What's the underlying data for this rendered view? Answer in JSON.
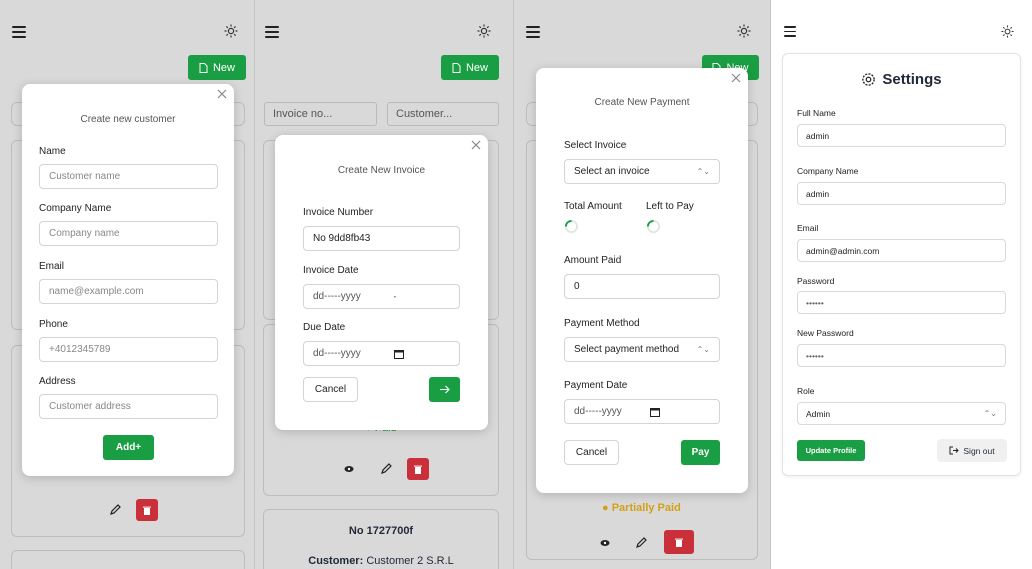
{
  "colors": {
    "accent": "#1a9e43",
    "danger": "#c9303a",
    "warning": "#d4a017"
  },
  "panel1": {
    "new_label": "New",
    "modal": {
      "title": "Create new customer",
      "fields": [
        {
          "label": "Name",
          "placeholder": "Customer name"
        },
        {
          "label": "Company Name",
          "placeholder": "Company name"
        },
        {
          "label": "Email",
          "placeholder": "name@example.com"
        },
        {
          "label": "Phone",
          "placeholder": "+4012345789"
        },
        {
          "label": "Address",
          "placeholder": "Customer address"
        }
      ],
      "add_label": "Add+"
    }
  },
  "panel2": {
    "new_label": "New",
    "filter_invoice": "Invoice no...",
    "filter_customer": "Customer...",
    "status_partial": "Paid",
    "card_invoice": "No 1727700f",
    "card_customer_label": "Customer:",
    "card_customer_value": "Customer 2 S.R.L",
    "modal": {
      "title": "Create New Invoice",
      "invoice_number_label": "Invoice Number",
      "invoice_number_value": "No 9dd8fb43",
      "invoice_date_label": "Invoice Date",
      "invoice_date_value": "dd-----yyyy",
      "due_date_label": "Due Date",
      "due_date_value": "dd-----yyyy",
      "cancel_label": "Cancel",
      "next_icon": "arrow-right-icon"
    }
  },
  "panel3": {
    "new_label": "New",
    "status": "Partially Paid",
    "modal": {
      "title": "Create New Payment",
      "select_invoice_label": "Select Invoice",
      "select_invoice_value": "Select an invoice",
      "total_amount_label": "Total Amount",
      "left_to_pay_label": "Left to Pay",
      "amount_paid_label": "Amount Paid",
      "amount_paid_value": "0",
      "payment_method_label": "Payment Method",
      "payment_method_value": "Select payment method",
      "payment_date_label": "Payment Date",
      "payment_date_value": "dd-----yyyy",
      "cancel_label": "Cancel",
      "pay_label": "Pay"
    }
  },
  "panel4": {
    "title": "Settings",
    "full_name_label": "Full Name",
    "full_name_value": "admin",
    "company_label": "Company Name",
    "company_value": "admin",
    "email_label": "Email",
    "email_value": "admin@admin.com",
    "password_label": "Password",
    "password_value": "••••••",
    "new_password_label": "New Password",
    "new_password_value": "••••••",
    "role_label": "Role",
    "role_value": "Admin",
    "update_label": "Update Profile",
    "signout_label": "Sign out"
  }
}
